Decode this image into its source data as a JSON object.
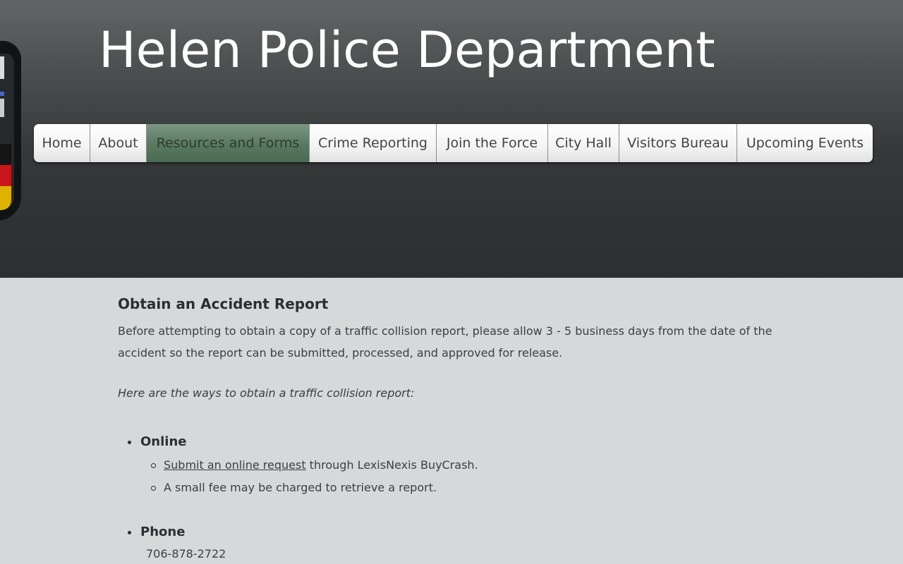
{
  "header": {
    "title": "Helen Police Department",
    "logo": "police-badge-icon"
  },
  "nav": {
    "active": "Resources and Forms",
    "items": [
      {
        "label": "Home"
      },
      {
        "label": "About"
      },
      {
        "label": "Resources and Forms"
      },
      {
        "label": "Crime Reporting"
      },
      {
        "label": "Join the Force"
      },
      {
        "label": "City Hall"
      },
      {
        "label": "Visitors Bureau"
      },
      {
        "label": "Upcoming Events"
      }
    ]
  },
  "content": {
    "heading": "Obtain an Accident Report",
    "intro": "Before attempting to obtain a copy of a traffic collision report, please allow 3 - 5 business days from the date of the accident so the report can be submitted, processed, and approved for release.",
    "ways_intro": "Here are the ways to obtain a traffic collision report:",
    "methods": {
      "online": {
        "title": "Online",
        "link_text": "Submit an online request",
        "link_suffix": " through LexisNexis BuyCrash.",
        "fee_note": "A small fee may be charged to retrieve a report."
      },
      "phone": {
        "title": "Phone",
        "number": "706-878-2722"
      }
    }
  },
  "colors": {
    "active_tab": "#587860",
    "page_background": "#d5d9da",
    "header_background": "#2c2f30"
  }
}
